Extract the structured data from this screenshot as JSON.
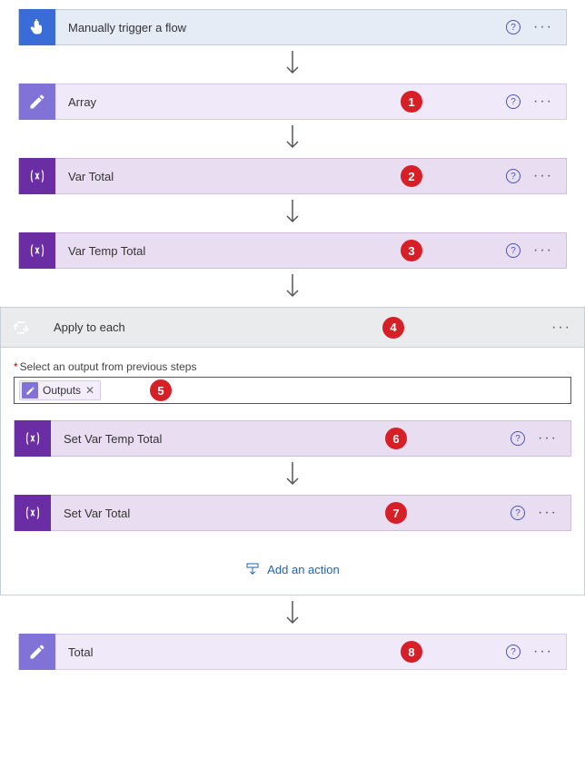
{
  "steps": {
    "trigger": {
      "title": "Manually trigger a flow"
    },
    "array": {
      "title": "Array",
      "badge": "1"
    },
    "varTotal": {
      "title": "Var Total",
      "badge": "2"
    },
    "varTempTotal": {
      "title": "Var Temp Total",
      "badge": "3"
    },
    "applyEach": {
      "title": "Apply to each",
      "badge": "4"
    },
    "setTemp": {
      "title": "Set Var Temp Total",
      "badge": "6"
    },
    "setTotal": {
      "title": "Set Var Total",
      "badge": "7"
    },
    "total": {
      "title": "Total",
      "badge": "8"
    }
  },
  "loop": {
    "fieldLabel": "Select an output from previous steps",
    "tokenLabel": "Outputs",
    "tokenBadge": "5",
    "addAction": "Add an action"
  }
}
